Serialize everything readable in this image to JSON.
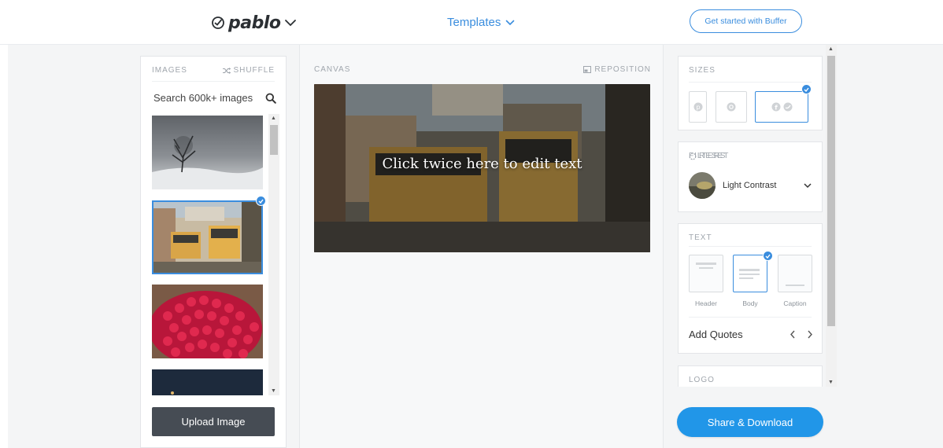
{
  "header": {
    "brand": "pablo",
    "templates_label": "Templates",
    "cta_label": "Get started with Buffer"
  },
  "images_panel": {
    "title": "IMAGES",
    "shuffle_label": "SHUFFLE",
    "search_placeholder": "Search 600k+ images",
    "thumbnails": [
      "snowy-tree",
      "lisbon-trams",
      "raspberries",
      "night-sky"
    ],
    "selected_index": 1,
    "upload_label": "Upload Image"
  },
  "canvas": {
    "title": "CANVAS",
    "reposition_label": "REPOSITION",
    "overlay_text": "Click twice here to edit text"
  },
  "sizes": {
    "title": "SIZES",
    "options": [
      "pinterest-icon",
      "instagram-icon",
      "facebook-twitter-icons"
    ],
    "selected_index": 2
  },
  "filters": {
    "title": "FILTERS",
    "reset_label": "RESET",
    "selected_filter": "Light Contrast"
  },
  "text": {
    "title": "TEXT",
    "options": [
      "Header",
      "Body",
      "Caption"
    ],
    "selected_index": 1,
    "quotes_label": "Add Quotes"
  },
  "logo": {
    "title": "LOGO"
  },
  "share_label": "Share & Download",
  "colors": {
    "accent": "#3a8dde",
    "share_button": "#2196e8",
    "upload_button": "#464c54"
  }
}
